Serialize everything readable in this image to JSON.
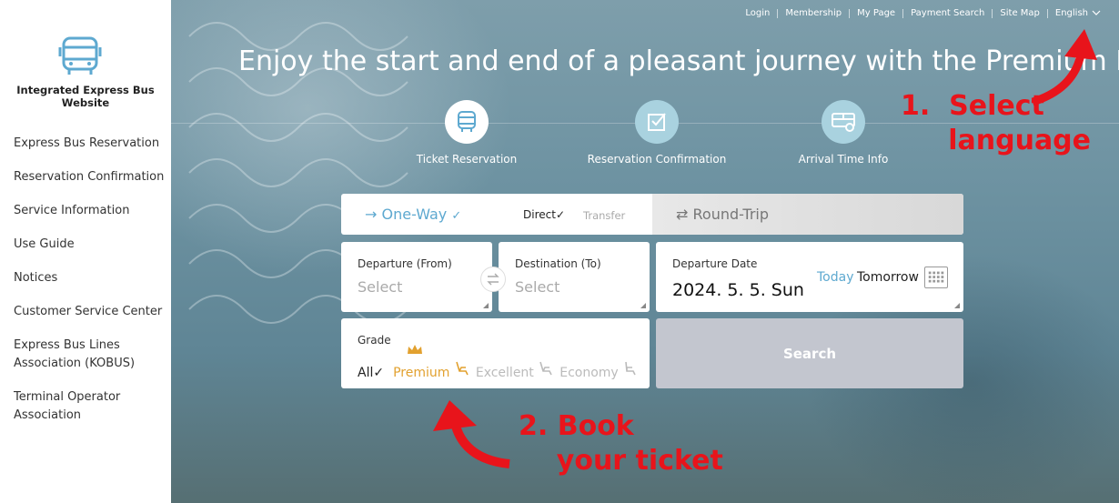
{
  "sidebar": {
    "site_title": "Integrated Express Bus Website",
    "items": [
      {
        "label": "Express Bus Reservation"
      },
      {
        "label": "Reservation Confirmation"
      },
      {
        "label": "Service Information"
      },
      {
        "label": "Use Guide"
      },
      {
        "label": "Notices"
      },
      {
        "label": "Customer Service Center"
      },
      {
        "label": "Express Bus Lines Association (KOBUS)"
      },
      {
        "label": "Terminal Operator Association"
      }
    ]
  },
  "topnav": {
    "login": "Login",
    "membership": "Membership",
    "my_page": "My Page",
    "payment_search": "Payment Search",
    "site_map": "Site Map",
    "language": "English"
  },
  "hero": {
    "headline": "Enjoy the start and end of a pleasant journey with the Premium Bus",
    "features": [
      {
        "label": "Ticket Reservation",
        "icon": "bus-icon"
      },
      {
        "label": "Reservation Confirmation",
        "icon": "checkbox-icon"
      },
      {
        "label": "Arrival Time Info",
        "icon": "bus-arrival-icon"
      }
    ]
  },
  "booking": {
    "one_way": "One-Way",
    "direct": "Direct",
    "transfer": "Transfer",
    "round_trip": "Round-Trip",
    "departure_label": "Departure (From)",
    "departure_placeholder": "Select",
    "destination_label": "Destination (To)",
    "destination_placeholder": "Select",
    "date_label": "Departure Date",
    "date_value": "2024. 5. 5. Sun",
    "today": "Today",
    "tomorrow": "Tomorrow",
    "grade_label": "Grade",
    "grades": {
      "all": "All",
      "premium": "Premium",
      "excellent": "Excellent",
      "economy": "Economy"
    },
    "search": "Search"
  },
  "annotations": {
    "select_language": "1.  Select\n     language",
    "book_ticket": "2. Book\n    your ticket"
  },
  "colors": {
    "accent_blue": "#5ea9d0",
    "premium_gold": "#e2a12f",
    "annotation_red": "#e8141b",
    "search_button": "#c3c6cf"
  }
}
